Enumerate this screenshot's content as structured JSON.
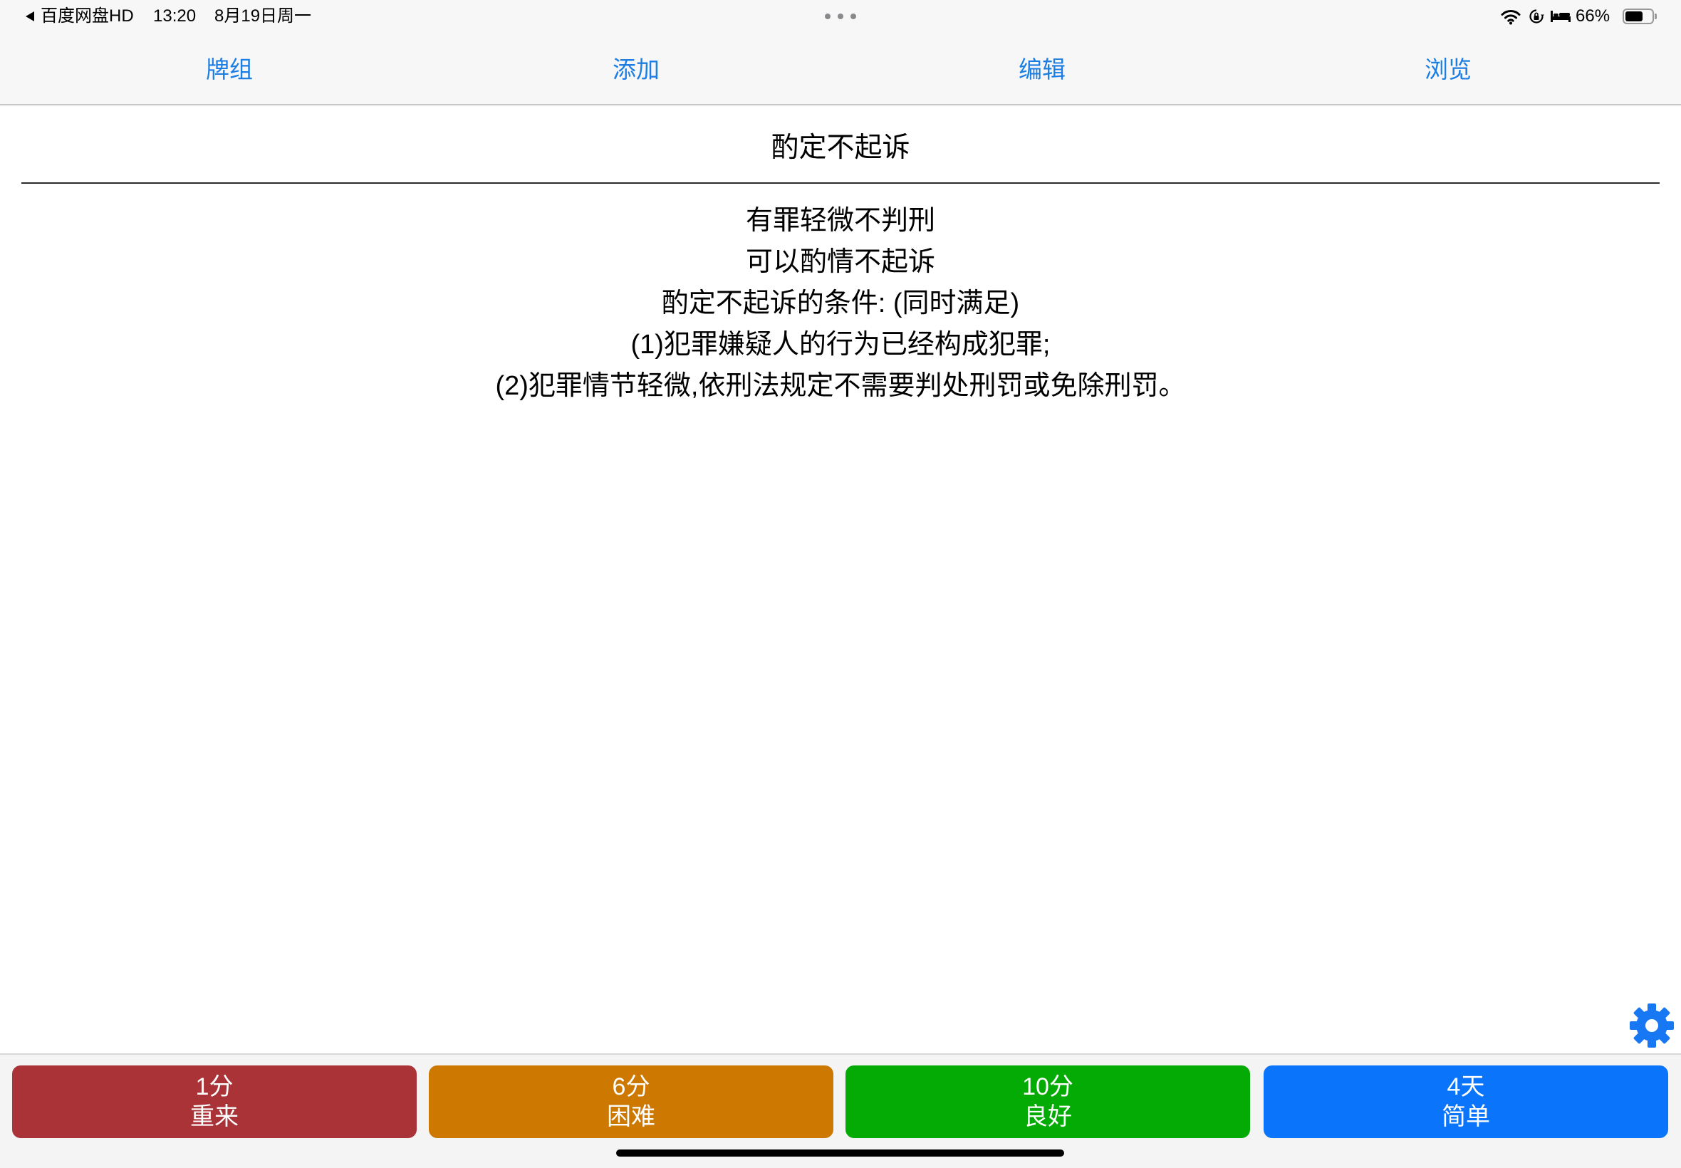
{
  "status_bar": {
    "back_app_label": "百度网盘HD",
    "time": "13:20",
    "date": "8月19日周一",
    "battery_text": "66%",
    "battery_level": 0.66,
    "icons": [
      "back-arrow-icon",
      "more-dots-icon",
      "wifi-icon",
      "orientation-lock-icon",
      "sleep-mode-icon",
      "battery-icon"
    ]
  },
  "nav": {
    "tabs": [
      {
        "label": "牌组"
      },
      {
        "label": "添加"
      },
      {
        "label": "编辑"
      },
      {
        "label": "浏览"
      }
    ],
    "color": "#1c7ee2"
  },
  "card": {
    "question": "酌定不起诉",
    "answer_lines": [
      "有罪轻微不判刑",
      "可以酌情不起诉",
      "酌定不起诉的条件: (同时满足)",
      "(1)犯罪嫌疑人的行为已经构成犯罪;",
      "(2)犯罪情节轻微,依刑法规定不需要判处刑罚或免除刑罚。"
    ]
  },
  "settings": {
    "icon": "gear-icon",
    "color": "#1877f2"
  },
  "answer_buttons": [
    {
      "interval": "1分",
      "label": "重来",
      "color": "#a93337"
    },
    {
      "interval": "6分",
      "label": "困难",
      "color": "#cc7801"
    },
    {
      "interval": "10分",
      "label": "良好",
      "color": "#04ab04"
    },
    {
      "interval": "4天",
      "label": "简单",
      "color": "#0a74fa"
    }
  ]
}
